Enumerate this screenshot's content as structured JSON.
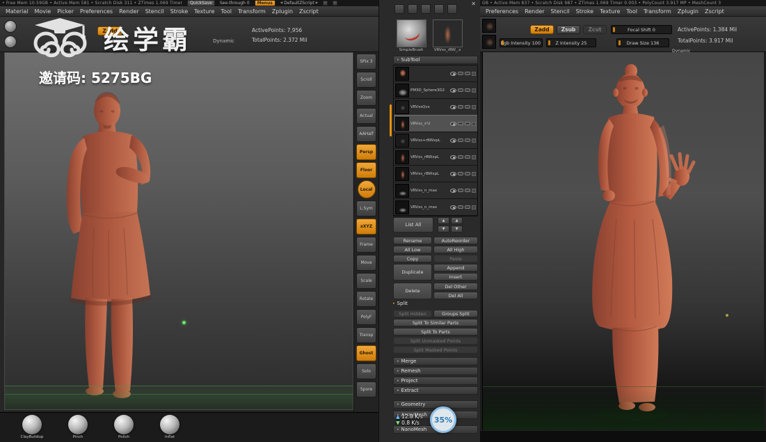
{
  "watermark": {
    "brand": "绘学霸",
    "invite_code": "邀请码: 5275BG"
  },
  "video_overlay": {
    "upload_speed": "12.8 K/s",
    "download_speed": "0.8 K/s",
    "buffer_percent": "35%"
  },
  "icons": {
    "close": "✕",
    "left_arrow": "◀",
    "right_arrow": "▶",
    "up_arrow": "▲",
    "down_arrow": "▼",
    "section_arrow": "▸"
  },
  "colors": {
    "accent_orange": "#e8920a",
    "clay": "#b55a41"
  },
  "left_window": {
    "titlebar": {
      "stats": "• Free Mem 10.59GB   • Active Mem 581   • Scratch Disk 311   • ZTimes 1.069 Timer",
      "quicksave": "QuickSave",
      "see_through": "See-through",
      "see_through_value": "0",
      "menus_button": "Menus",
      "zscript_selector": "DefaultZScript"
    },
    "menus": [
      "Material",
      "Movie",
      "Picker",
      "Preferences",
      "Render",
      "Stencil",
      "Stroke",
      "Texture",
      "Tool",
      "Transform",
      "Zplugin",
      "Zscript"
    ],
    "shelf": {
      "zadd": "Zadd",
      "dynamic": "Dynamic",
      "active_points": "ActivePoints: 7,956",
      "total_points": "TotalPoints: 2.372 Mil"
    },
    "right_tray": [
      {
        "label": "SPix 3"
      },
      {
        "label": "Scroll"
      },
      {
        "label": "Zoom"
      },
      {
        "label": "Actual"
      },
      {
        "label": "AAHalf"
      },
      {
        "label": "Persp"
      },
      {
        "label": "Floor"
      },
      {
        "label": "Local"
      },
      {
        "label": "L.Sym"
      },
      {
        "label": "xXYZ"
      },
      {
        "label": "Frame"
      },
      {
        "label": "Move"
      },
      {
        "label": "Scale"
      },
      {
        "label": "Rotate"
      },
      {
        "label": "PolyF"
      },
      {
        "label": "Transp"
      },
      {
        "label": "Ghost"
      },
      {
        "label": "Solo"
      },
      {
        "label": "Spore"
      }
    ],
    "bottom_brushes": [
      "ClayBuildup",
      "Pinch",
      "Polish",
      "Inflat"
    ]
  },
  "tool_panel": {
    "brush_thumb_label": "SimpleBrush",
    "tool_thumb_label": "VRVxs_rBW_.s",
    "subtool_header": "SubTool",
    "subtools": [
      {
        "name": ""
      },
      {
        "name": "PM3D_Sphere3D2"
      },
      {
        "name": "VRVxsQvs"
      },
      {
        "name": "VRVxs_s'U"
      },
      {
        "name": "VRVxs+rBWxpL"
      },
      {
        "name": "VRVxs_rBWxpL"
      },
      {
        "name": "VRVxs_rBWxpL"
      },
      {
        "name": "VRVxs_n_max"
      },
      {
        "name": "VRVxs_n_max"
      }
    ],
    "list_all": "List All",
    "buttons": {
      "rename": "Rename",
      "autoreorder": "AutoReorder",
      "all_low": "All Low",
      "all_high": "All High",
      "copy": "Copy",
      "paste": "Paste",
      "duplicate": "Duplicate",
      "append": "Append",
      "insert": "Insert",
      "delete": "Delete",
      "del_other": "Del Other",
      "del_all": "Del All"
    },
    "split": {
      "header": "Split",
      "split_hidden": "Split Hidden",
      "groups_split": "Groups Split",
      "split_similar": "Split To Similar Parts",
      "split_to_parts": "Split To Parts",
      "split_unmasked": "Split Unmasked Points",
      "split_masked": "Split Masked Points"
    },
    "sections": [
      "Merge",
      "Remesh",
      "Project",
      "Extract",
      "Geometry",
      "ArrayMesh",
      "NanoMesh"
    ]
  },
  "right_window": {
    "titlebar": {
      "stats": "GB   • Active Mem 837   • Scratch Disk 987   • ZTimes 1.069 Timer 0.003   • PolyCount 3.917 MP   • MeshCount 3"
    },
    "menus": [
      "Preferences",
      "Render",
      "Stencil",
      "Stroke",
      "Texture",
      "Tool",
      "Transform",
      "Zplugin",
      "Zscript"
    ],
    "shelf": {
      "zadd": "Zadd",
      "zsub": "Zsub",
      "zcut": "Zcut",
      "focal_shift": "Focal Shift 0",
      "rgb_intensity": "Rgb Intensity 100",
      "z_intensity": "Z Intensity 25",
      "draw_size": "Draw Size 136",
      "dynamic": "Dynamic",
      "active_points": "ActivePoints: 1.384 Mil",
      "total_points": "TotalPoints: 3.917 Mil"
    }
  }
}
